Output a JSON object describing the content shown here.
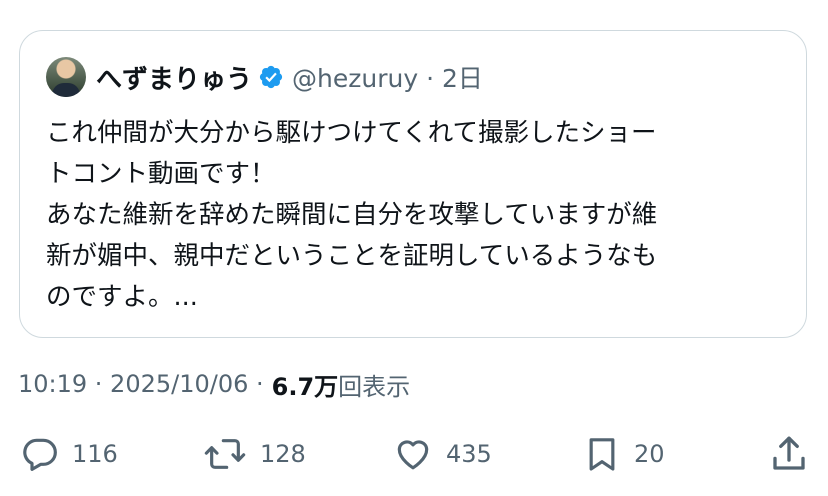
{
  "author": {
    "name": "へずまりゅう",
    "handle": "@hezuruy",
    "separator": "·",
    "time_ago": "2日"
  },
  "tweet": {
    "lines": [
      "これ仲間が大分から駆けつけてくれて撮影したショー",
      "トコント動画です！",
      "あなた維新を辞めた瞬間に自分を攻撃していますが維",
      "新が媚中、親中だということを証明しているようなも",
      "のですよ。..."
    ]
  },
  "meta": {
    "timestamp": "10:19 · 2025/10/06 ·",
    "views_count": "6.7万",
    "views_label": "回表示"
  },
  "actions": {
    "replies": "116",
    "reposts": "128",
    "likes": "435",
    "bookmarks": "20"
  },
  "colors": {
    "verified": "#1d9bf0",
    "muted": "#536471",
    "text": "#0f1419",
    "border": "#cfd9de"
  }
}
